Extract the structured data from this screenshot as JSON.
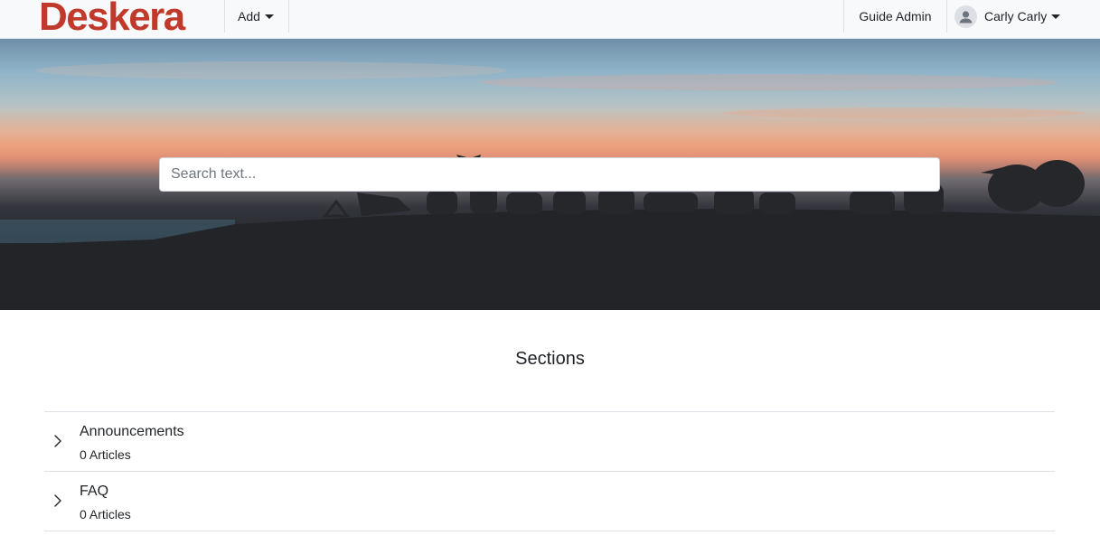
{
  "nav": {
    "logo_text": "Deskera",
    "add_label": "Add",
    "guide_admin_label": "Guide Admin",
    "user_name": "Carly Carly"
  },
  "hero": {
    "search_placeholder": "Search text..."
  },
  "sections": {
    "title": "Sections",
    "items": [
      {
        "name": "Announcements",
        "count": "0 Articles"
      },
      {
        "name": "FAQ",
        "count": "0 Articles"
      }
    ]
  },
  "colors": {
    "brand": "#c0392b",
    "nav_bg": "#f8f9fa",
    "divider": "#dee2e6"
  },
  "icons": {
    "dropdown": "caret-down-icon",
    "avatar": "user-avatar-icon",
    "expand": "chevron-right-icon"
  }
}
